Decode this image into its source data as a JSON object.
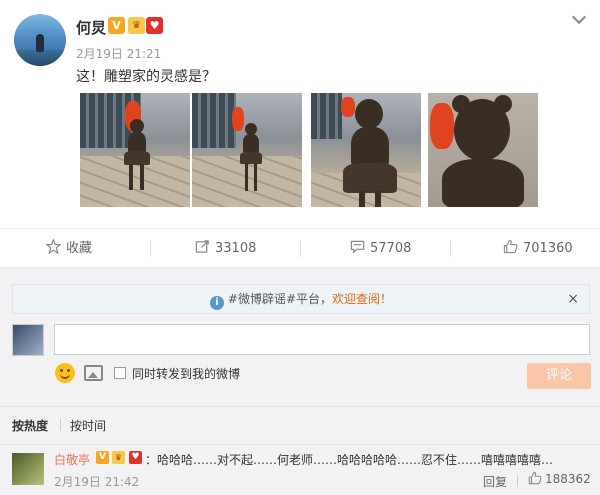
{
  "post": {
    "author": "何炅",
    "badges": {
      "verified": "V",
      "crown": "♛",
      "heart": "♥"
    },
    "time": "2月19日 21:21",
    "text": "这！雕塑家的灵感是？",
    "photo_count": 4
  },
  "actions": {
    "favorite_label": "收藏",
    "repost_count": "33108",
    "comment_count": "57708",
    "like_count": "701360"
  },
  "notice": {
    "prefix": "#微博辟谣#平台，",
    "highlight": "欢迎查阅！",
    "close": "×"
  },
  "composer": {
    "input_value": "",
    "repost_label": "同时转发到我的微博",
    "submit_label": "评论"
  },
  "sort": {
    "hot_label": "按热度",
    "time_label": "按时间"
  },
  "comments": [
    {
      "author": "白敬亭",
      "text": "：哈哈哈……对不起……何老师……哈哈哈哈哈……忍不住……嘻嘻嘻嘻嘻…",
      "time": "2月19日 21:42",
      "reply_label": "回复",
      "like_count": "188362"
    }
  ],
  "colors": {
    "accent_orange": "#eb7350",
    "submit_disabled": "#f9c7a8",
    "notice_bg": "#eef3f8",
    "comment_area_bg": "#f2f2f5"
  }
}
